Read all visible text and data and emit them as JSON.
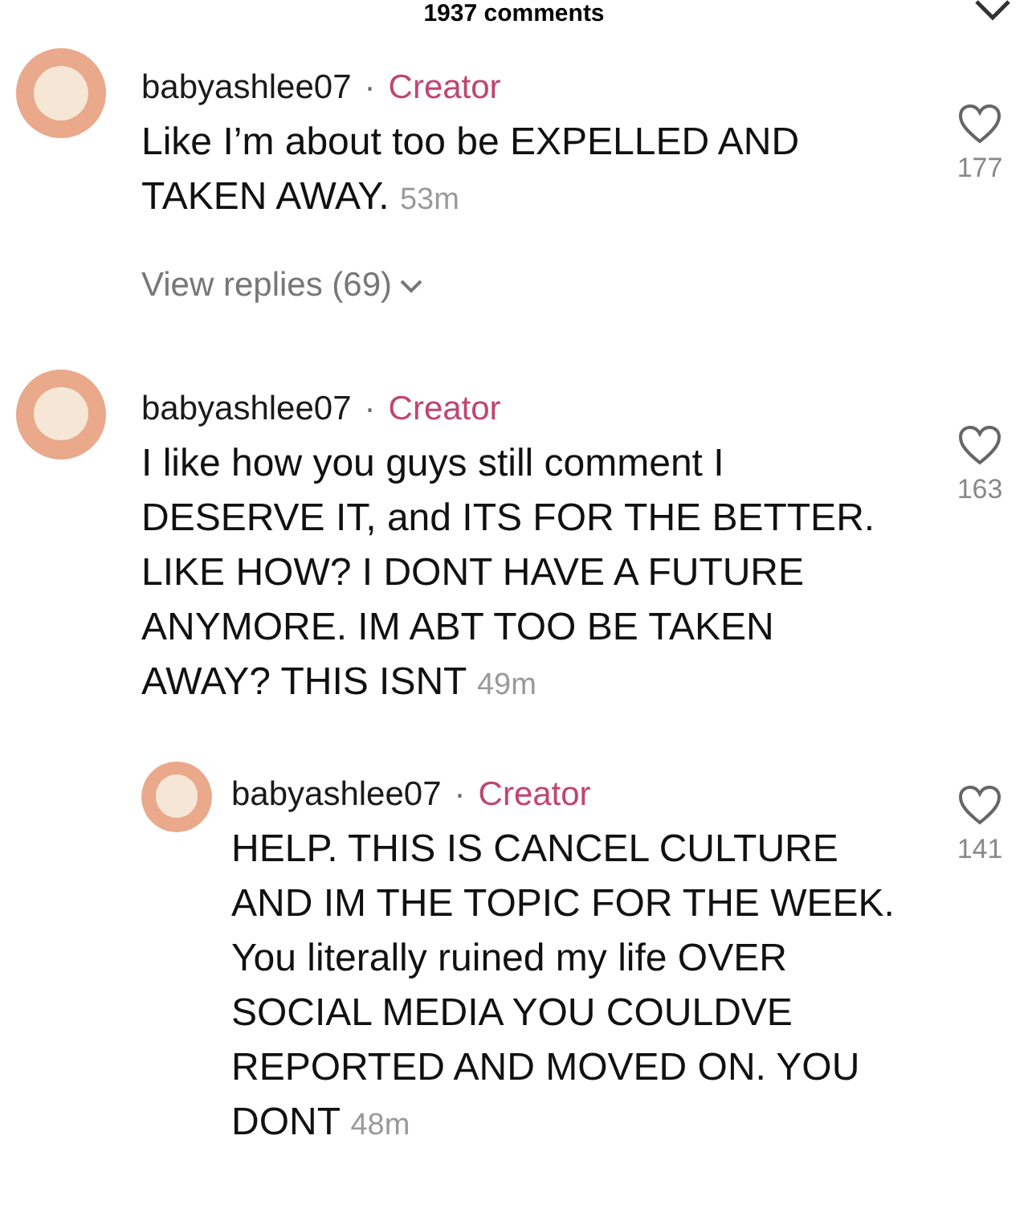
{
  "header": {
    "title": "1937 comments"
  },
  "comments": [
    {
      "username": "babyashlee07",
      "separator": "·",
      "badge": "Creator",
      "text": "Like I’m about too be EXPELLED AND TAKEN AWAY.",
      "time": "53m",
      "likes": "177",
      "view_replies": "View replies (69)"
    },
    {
      "username": "babyashlee07",
      "separator": "·",
      "badge": "Creator",
      "text": "I like how you guys still comment I DESERVE IT, and ITS FOR THE BETTER. LIKE HOW? I DONT HAVE A FUTURE ANYMORE. IM ABT TOO BE TAKEN AWAY? THIS ISNT",
      "time": "49m",
      "likes": "163",
      "replies": [
        {
          "username": "babyashlee07",
          "separator": "·",
          "badge": "Creator",
          "text": "HELP. THIS IS CANCEL CULTURE AND IM THE TOPIC FOR THE WEEK. You literally ruined my life OVER SOCIAL MEDIA YOU COULDVE REPORTED AND MOVED ON. YOU DONT",
          "time": "48m",
          "likes": "141"
        }
      ]
    }
  ]
}
